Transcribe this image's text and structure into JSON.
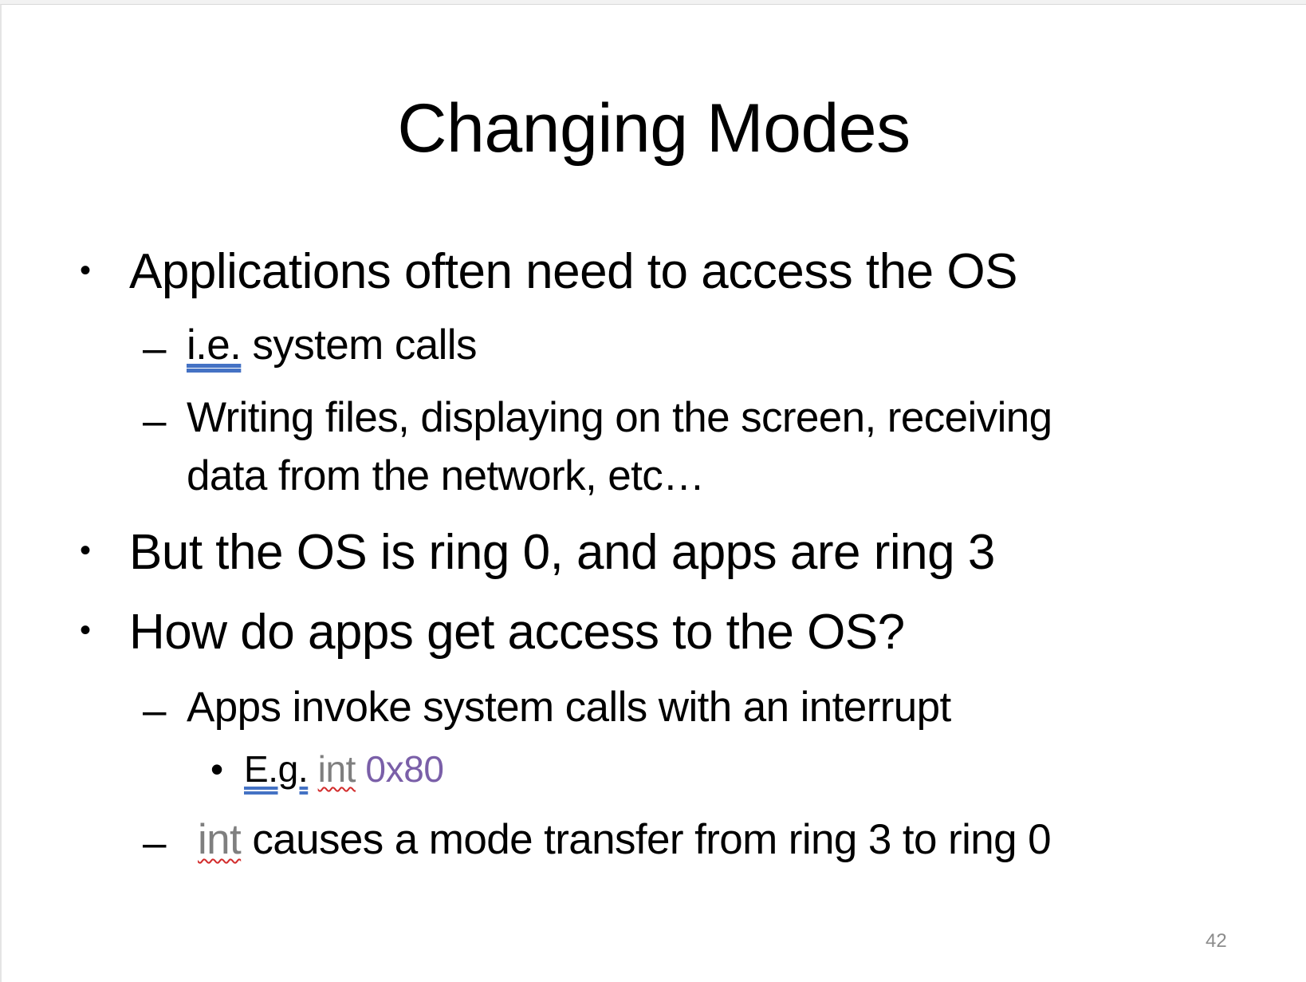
{
  "slide": {
    "title": "Changing Modes",
    "page_number": "42",
    "bullets": {
      "b1": "Applications often need to access the OS",
      "b1_sub1_abbr": "i.e.",
      "b1_sub1_rest": " system calls",
      "b1_sub2_line1": "Writing files, displaying on the screen, receiving",
      "b1_sub2_line2": "data from the network, etc…",
      "b2": "But the OS is ring 0, and apps are ring 3",
      "b3": "How do apps get access to the OS?",
      "b3_sub1": "Apps invoke system calls with an interrupt",
      "b3_sub1_sub_abbr": "E.g.",
      "b3_sub1_sub_code": "int",
      "b3_sub1_sub_value": "0x80",
      "b3_sub2_code": "int",
      "b3_sub2_rest": " causes a mode transfer from ring 3 to ring 0"
    },
    "markers": {
      "bullet": "•",
      "dash": "–"
    },
    "colors": {
      "code_gray": "#7f7f7f",
      "hex_purple": "#7a5fa8",
      "abbr_underline": "#4472c4",
      "spellcheck": "#d22b2b"
    }
  }
}
